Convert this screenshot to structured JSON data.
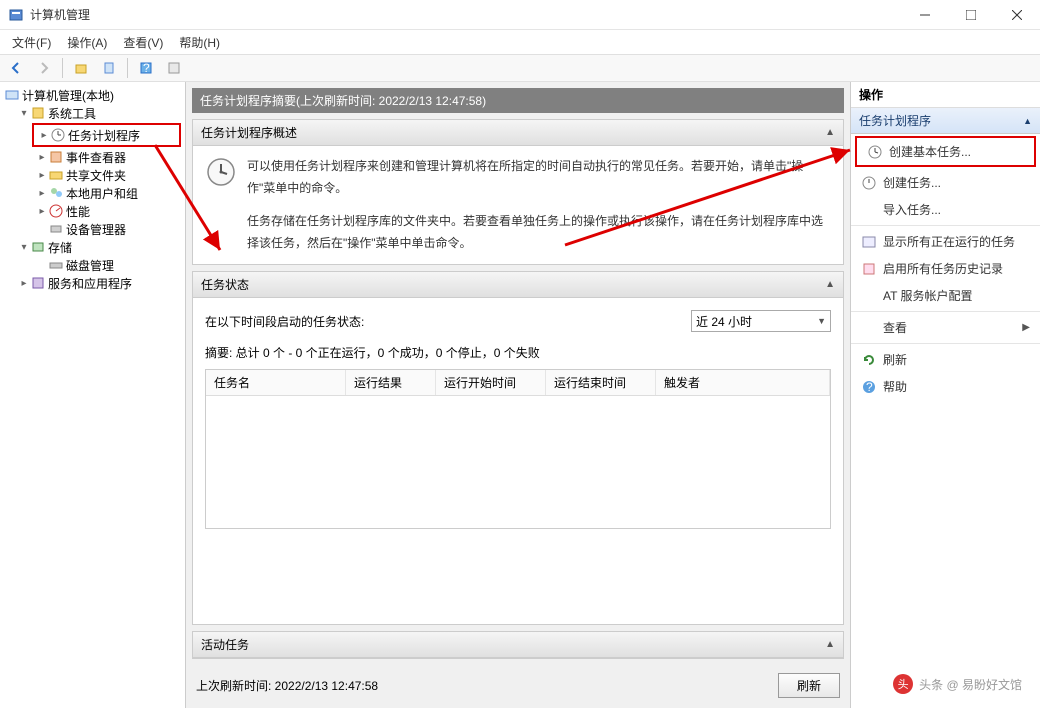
{
  "window": {
    "title": "计算机管理"
  },
  "menu": {
    "file": "文件(F)",
    "action": "操作(A)",
    "view": "查看(V)",
    "help": "帮助(H)"
  },
  "tree": {
    "root": "计算机管理(本地)",
    "systools": "系统工具",
    "scheduler": "任务计划程序",
    "eventviewer": "事件查看器",
    "shared": "共享文件夹",
    "users": "本地用户和组",
    "perf": "性能",
    "devmgr": "设备管理器",
    "storage": "存储",
    "diskmgmt": "磁盘管理",
    "services": "服务和应用程序"
  },
  "center": {
    "summary_header": "任务计划程序摘要(上次刷新时间: 2022/2/13 12:47:58)",
    "overview": {
      "title": "任务计划程序概述",
      "p1": "可以使用任务计划程序来创建和管理计算机将在所指定的时间自动执行的常见任务。若要开始，请单击\"操作\"菜单中的命令。",
      "p2": "任务存储在任务计划程序库的文件夹中。若要查看单独任务上的操作或执行该操作，请在任务计划程序库中选择该任务，然后在\"操作\"菜单中单击命令。"
    },
    "status": {
      "title": "任务状态",
      "period_label": "在以下时间段启动的任务状态:",
      "period_value": "近 24 小时",
      "summary": "摘要: 总计 0 个 - 0 个正在运行，0 个成功，0 个停止，0 个失败"
    },
    "table": {
      "c1": "任务名",
      "c2": "运行结果",
      "c3": "运行开始时间",
      "c4": "运行结束时间",
      "c5": "触发者"
    },
    "active": {
      "title": "活动任务"
    },
    "footer": {
      "last_refresh": "上次刷新时间: 2022/2/13 12:47:58",
      "refresh": "刷新"
    }
  },
  "actions": {
    "header": "操作",
    "sub": "任务计划程序",
    "create_basic": "创建基本任务...",
    "create": "创建任务...",
    "import": "导入任务...",
    "show_running": "显示所有正在运行的任务",
    "enable_history": "启用所有任务历史记录",
    "at_account": "AT 服务帐户配置",
    "view": "查看",
    "refresh": "刷新",
    "help": "帮助"
  },
  "watermark": "头条 @ 易盼好文馆"
}
